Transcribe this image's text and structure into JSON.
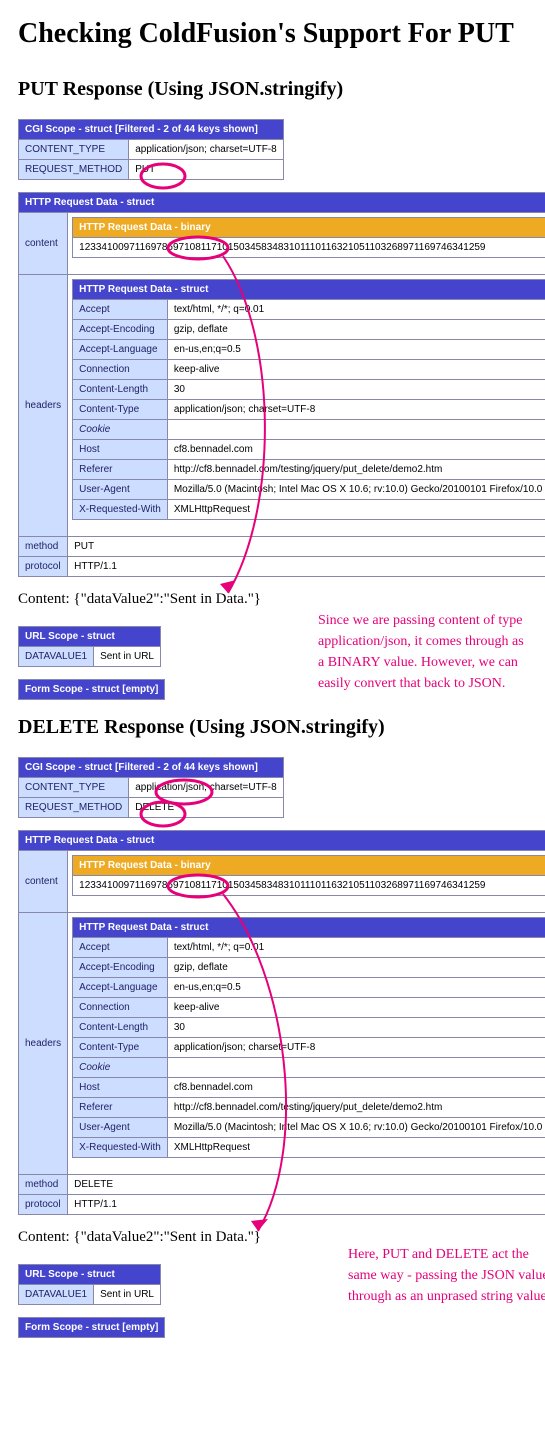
{
  "title": "Checking ColdFusion's Support For PUT",
  "put": {
    "heading": "PUT Response (Using JSON.stringify)",
    "cgi": {
      "header": "CGI Scope - struct [Filtered - 2 of 44 keys shown]",
      "rows": [
        {
          "k": "CONTENT_TYPE",
          "v": "application/json; charset=UTF-8"
        },
        {
          "k": "REQUEST_METHOD",
          "v": "PUT"
        }
      ]
    },
    "req": {
      "header": "HTTP Request Data - struct",
      "binary_header": "HTTP Request Data - binary",
      "binary_val": "12334100971169786971081171015034583483101110116321051103268971169746341259",
      "headers_header": "HTTP Request Data - struct",
      "header_rows": [
        {
          "k": "Accept",
          "v": "text/html, */*; q=0.01"
        },
        {
          "k": "Accept-Encoding",
          "v": "gzip, deflate"
        },
        {
          "k": "Accept-Language",
          "v": "en-us,en;q=0.5"
        },
        {
          "k": "Connection",
          "v": "keep-alive"
        },
        {
          "k": "Content-Length",
          "v": "30"
        },
        {
          "k": "Content-Type",
          "v": "application/json; charset=UTF-8"
        },
        {
          "k": "Cookie",
          "v": "",
          "empty": true
        },
        {
          "k": "Host",
          "v": "cf8.bennadel.com"
        },
        {
          "k": "Referer",
          "v": "http://cf8.bennadel.com/testing/jquery/put_delete/demo2.htm"
        },
        {
          "k": "User-Agent",
          "v": "Mozilla/5.0 (Macintosh; Intel Mac OS X 10.6; rv:10.0) Gecko/20100101 Firefox/10.0"
        },
        {
          "k": "X-Requested-With",
          "v": "XMLHttpRequest"
        }
      ],
      "method": "PUT",
      "protocol": "HTTP/1.1"
    },
    "content_line": "Content: {\"dataValue2\":\"Sent in Data.\"}",
    "url_scope": {
      "header": "URL Scope - struct",
      "rows": [
        {
          "k": "DATAVALUE1",
          "v": "Sent in URL"
        }
      ]
    },
    "form_scope": "Form Scope - struct [empty]",
    "annotation": "Since we are passing content of type application/json, it comes through as a BINARY value. However, we can easily convert that back to JSON."
  },
  "del": {
    "heading": "DELETE Response (Using JSON.stringify)",
    "cgi": {
      "header": "CGI Scope - struct [Filtered - 2 of 44 keys shown]",
      "rows": [
        {
          "k": "CONTENT_TYPE",
          "v": "application/json; charset=UTF-8"
        },
        {
          "k": "REQUEST_METHOD",
          "v": "DELETE"
        }
      ]
    },
    "req": {
      "header": "HTTP Request Data - struct",
      "binary_header": "HTTP Request Data - binary",
      "binary_val": "12334100971169786971081171015034583483101110116321051103268971169746341259",
      "headers_header": "HTTP Request Data - struct",
      "header_rows": [
        {
          "k": "Accept",
          "v": "text/html, */*; q=0.01"
        },
        {
          "k": "Accept-Encoding",
          "v": "gzip, deflate"
        },
        {
          "k": "Accept-Language",
          "v": "en-us,en;q=0.5"
        },
        {
          "k": "Connection",
          "v": "keep-alive"
        },
        {
          "k": "Content-Length",
          "v": "30"
        },
        {
          "k": "Content-Type",
          "v": "application/json; charset=UTF-8"
        },
        {
          "k": "Cookie",
          "v": "",
          "empty": true
        },
        {
          "k": "Host",
          "v": "cf8.bennadel.com"
        },
        {
          "k": "Referer",
          "v": "http://cf8.bennadel.com/testing/jquery/put_delete/demo2.htm"
        },
        {
          "k": "User-Agent",
          "v": "Mozilla/5.0 (Macintosh; Intel Mac OS X 10.6; rv:10.0) Gecko/20100101 Firefox/10.0"
        },
        {
          "k": "X-Requested-With",
          "v": "XMLHttpRequest"
        }
      ],
      "method": "DELETE",
      "protocol": "HTTP/1.1"
    },
    "content_line": "Content: {\"dataValue2\":\"Sent in Data.\"}",
    "url_scope": {
      "header": "URL Scope - struct",
      "rows": [
        {
          "k": "DATAVALUE1",
          "v": "Sent in URL"
        }
      ]
    },
    "form_scope": "Form Scope - struct [empty]",
    "annotation": "Here, PUT and DELETE act the same way - passing the JSON value through as an unprased string value."
  }
}
